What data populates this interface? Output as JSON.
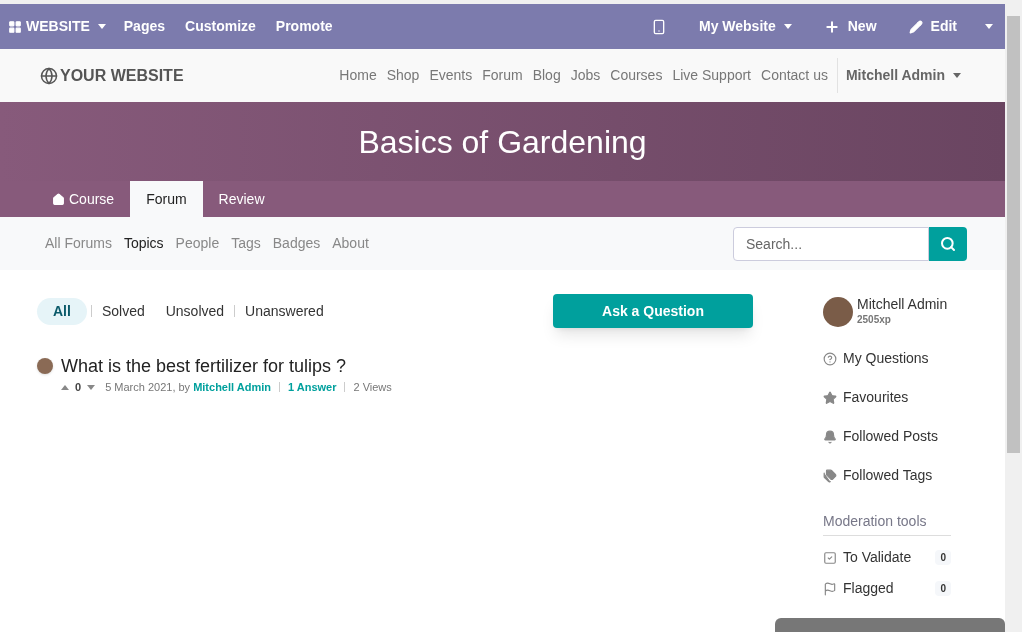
{
  "admin_bar": {
    "app_menu": "WEBSITE",
    "left_items": [
      "Pages",
      "Customize",
      "Promote"
    ],
    "website_menu": "My Website",
    "new_button": "New",
    "edit_button": "Edit"
  },
  "header": {
    "logo": "YOUR WEBSITE",
    "nav": [
      "Home",
      "Shop",
      "Events",
      "Forum",
      "Blog",
      "Jobs",
      "Courses",
      "Live Support",
      "Contact us"
    ],
    "user_menu": "Mitchell Admin"
  },
  "banner": {
    "title": "Basics of Gardening",
    "tabs": [
      {
        "label": "Course",
        "selected": false,
        "kind": "home"
      },
      {
        "label": "Forum",
        "selected": true,
        "kind": "plain"
      },
      {
        "label": "Review",
        "selected": false,
        "kind": "plain"
      }
    ]
  },
  "forum_nav": {
    "items": [
      {
        "label": "All Forums",
        "selected": false
      },
      {
        "label": "Topics",
        "selected": true
      },
      {
        "label": "People",
        "selected": false
      },
      {
        "label": "Tags",
        "selected": false
      },
      {
        "label": "Badges",
        "selected": false
      },
      {
        "label": "About",
        "selected": false
      }
    ],
    "search": {
      "placeholder": "Search..."
    }
  },
  "filters": [
    {
      "label": "All",
      "selected": true,
      "divider_after": true
    },
    {
      "label": "Solved",
      "selected": false,
      "divider_after": false
    },
    {
      "label": "Unsolved",
      "selected": false,
      "divider_after": true
    },
    {
      "label": "Unanswered",
      "selected": false,
      "divider_after": false
    }
  ],
  "ask_button": "Ask a Question",
  "posts": [
    {
      "title": "What is the best fertilizer for tulips ?",
      "votes": "0",
      "date": "5 March 2021, by",
      "author": "Mitchell Admin",
      "answers": "1 Answer",
      "views": "2 Views"
    }
  ],
  "sidebar": {
    "user": {
      "name": "Mitchell Admin",
      "xp": "2505xp"
    },
    "links": [
      {
        "label": "My Questions",
        "kind": "question"
      },
      {
        "label": "Favourites",
        "kind": "star"
      },
      {
        "label": "Followed Posts",
        "kind": "bell"
      },
      {
        "label": "Followed Tags",
        "kind": "tags"
      }
    ],
    "moderation": {
      "title": "Moderation tools",
      "items": [
        {
          "label": "To Validate",
          "count": "0",
          "kind": "check"
        },
        {
          "label": "Flagged",
          "count": "0",
          "kind": "flag"
        }
      ]
    }
  }
}
